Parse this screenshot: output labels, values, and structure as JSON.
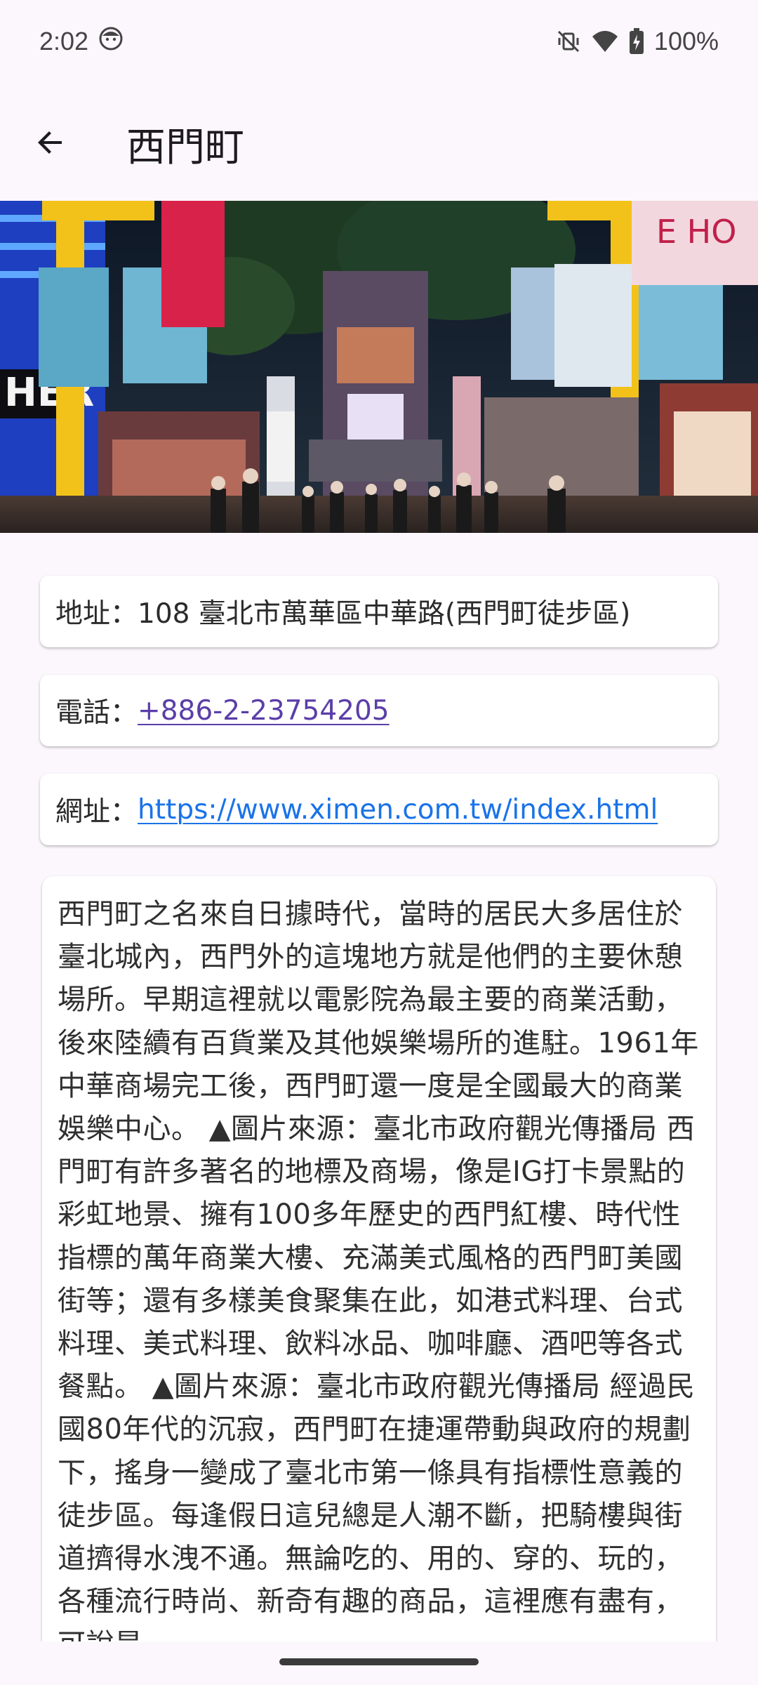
{
  "status_bar": {
    "time": "2:02",
    "battery": "100%",
    "icons": [
      "face-icon",
      "mute-vibrate-icon",
      "wifi-icon",
      "battery-charging-icon"
    ]
  },
  "app_bar": {
    "title": "西門町",
    "back_icon": "arrow-back-icon"
  },
  "hero_image": {
    "description_icon": "street-photo"
  },
  "details": {
    "address_label": "地址：",
    "address_value": "108 臺北市萬華區中華路(西門町徒步區)",
    "phone_label": "電話：",
    "phone_value": "+886-2-23754205",
    "website_label": "網址：",
    "website_value": "https://www.ximen.com.tw/index.html"
  },
  "description": "西門町之名來自日據時代，當時的居民大多居住於臺北城內，西門外的這塊地方就是他們的主要休憩場所。早期這裡就以電影院為最主要的商業活動，後來陸續有百貨業及其他娛樂場所的進駐。1961年中華商場完工後，西門町還一度是全國最大的商業娛樂中心。 ▲圖片來源：臺北市政府觀光傳播局 西門町有許多著名的地標及商場，像是IG打卡景點的彩虹地景、擁有100多年歷史的西門紅樓、時代性指標的萬年商業大樓、充滿美式風格的西門町美國街等；還有多樣美食聚集在此，如港式料理、台式料理、美式料理、飲料冰品、咖啡廳、酒吧等各式餐點。 ▲圖片來源：臺北市政府觀光傳播局 經過民國80年代的沉寂，西門町在捷運帶動與政府的規劃下，搖身一變成了臺北市第一條具有指標性意義的徒步區。每逢假日這兒總是人潮不斷，把騎樓與街道擠得水洩不通。無論吃的、用的、穿的、玩的，各種流行時尚、新奇有趣的商品，這裡應有盡有，可說是",
  "colors": {
    "background": "#fcf7fd",
    "phone_link": "#5b3ea8",
    "web_link": "#1a73e8"
  }
}
